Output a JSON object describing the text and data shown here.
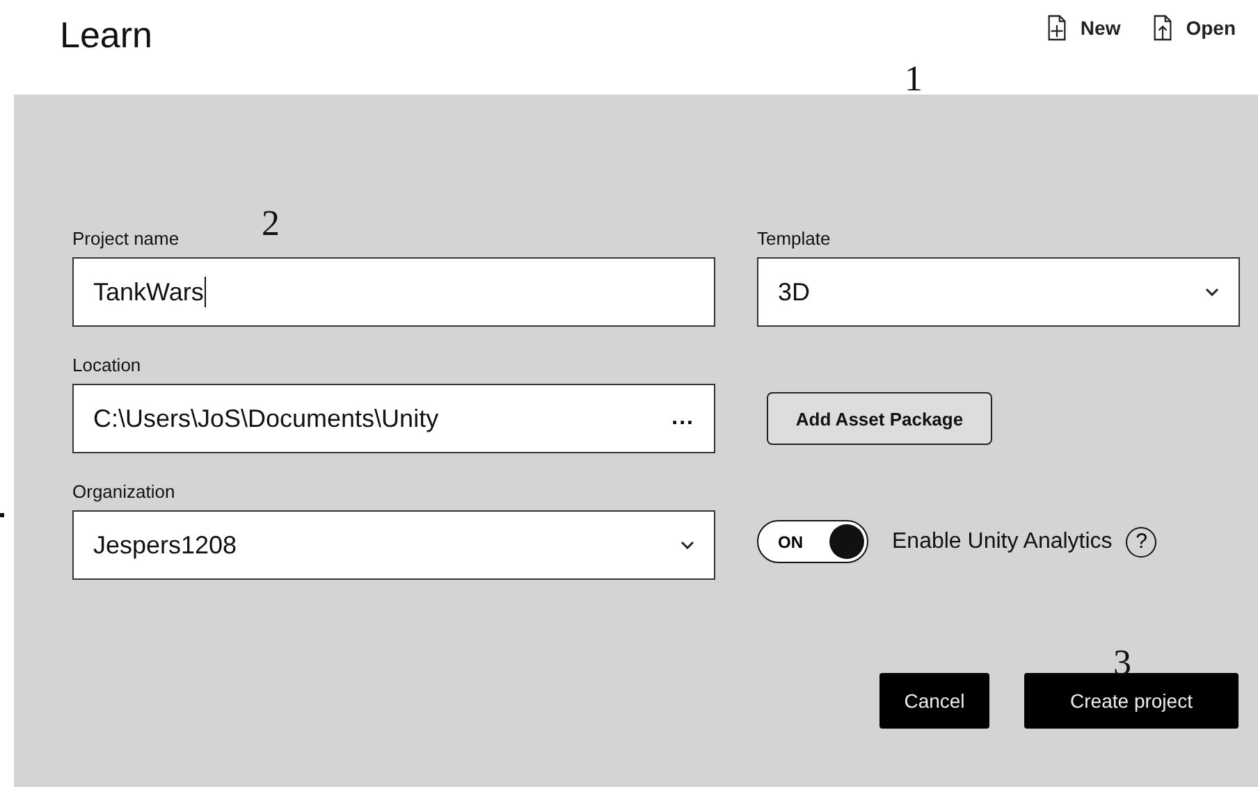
{
  "header": {
    "title": "Learn",
    "actions": [
      {
        "kind": "new",
        "label": "New"
      },
      {
        "kind": "open",
        "label": "Open"
      }
    ]
  },
  "callouts": [
    {
      "kind": "header",
      "label": "1"
    },
    {
      "kind": "name",
      "label": "2"
    },
    {
      "kind": "create",
      "label": "3"
    }
  ],
  "form": {
    "project_name": {
      "label": "Project name",
      "value": "TankWars"
    },
    "template": {
      "label": "Template",
      "value": "3D"
    },
    "location": {
      "label": "Location",
      "value": "C:\\Users\\JoS\\Documents\\Unity",
      "browse": "..."
    },
    "add_asset_button": "Add Asset Package",
    "organization": {
      "label": "Organization",
      "value": "Jespers1208"
    },
    "analytics": {
      "toggle_label": "ON",
      "on": true,
      "label": "Enable Unity Analytics",
      "help": "?"
    }
  },
  "buttons": [
    {
      "kind": "cancel",
      "label": "Cancel"
    },
    {
      "kind": "create",
      "label": "Create project"
    }
  ]
}
